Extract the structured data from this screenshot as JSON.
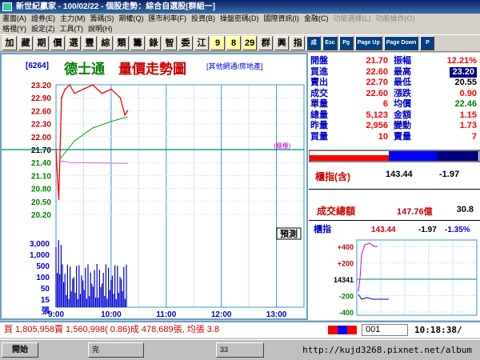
{
  "window": {
    "title": "新世紀贏家 - 100/02/22 - 個股走勢：綜合自選股[群組一]"
  },
  "menu": {
    "row1": [
      "畫面(A)",
      "證券(E)",
      "主力(M)",
      "籌碼(S)",
      "期權(Q)",
      "匯市利率(F)",
      "投資(B)",
      "操盤密碼(D)",
      "國際資訊(I)",
      "金融(C)",
      "功能選擇(L)",
      "功能操作(O)"
    ],
    "row2": [
      "格視(Y)",
      "設定(Z)",
      "工具(T)",
      "說明(H)"
    ]
  },
  "toolbar": {
    "buttons": [
      "加",
      "藏",
      "期",
      "價",
      "選",
      "豐",
      "綜",
      "類",
      "籌",
      "錄",
      "智",
      "委",
      "江",
      "9",
      "8",
      "29",
      "群",
      "興",
      "指"
    ],
    "extra": [
      "成",
      "Esc",
      "Pg",
      "Page Up",
      "Page Down",
      "P"
    ]
  },
  "stock": {
    "code": "[6264]",
    "name": "德士通",
    "chart_title": "量價走勢圖",
    "industry": "[其他網通/房地產]"
  },
  "price_axis": [
    "23.20",
    "22.90",
    "22.60",
    "22.30",
    "22.00",
    "21.70",
    "21.40",
    "21.10",
    "20.80",
    "20.50",
    "20.20"
  ],
  "ref_label": "(櫃檯)",
  "volume_axis": [
    "3,000",
    "1,000",
    "500",
    "100",
    "50",
    "15",
    "張"
  ],
  "time_axis": [
    "9:00",
    "10:00",
    "11:00",
    "12:00",
    "13:00"
  ],
  "prediction_label": "預測",
  "quote": {
    "rows": [
      {
        "l1": "開盤",
        "v1": "21.70",
        "l2": "振幅",
        "v2": "12.21%"
      },
      {
        "l1": "買進",
        "v1": "22.60",
        "l2": "最高",
        "v2": "23.20"
      },
      {
        "l1": "賣出",
        "v1": "22.70",
        "l2": "最低",
        "v2": "20.55"
      },
      {
        "l1": "成交",
        "v1": "22.60",
        "l2": "漲跌",
        "v2": "0.90"
      },
      {
        "l1": "單量",
        "v1": "6",
        "l2": "均價",
        "v2": "22.46"
      },
      {
        "l1": "總量",
        "v1": "5,123",
        "l2": "金額",
        "v2": "1.15"
      },
      {
        "l1": "昨量",
        "v1": "2,956",
        "l2": "變動",
        "v2": "1.73"
      },
      {
        "l1": "買量",
        "v1": "10",
        "l2": "賣量",
        "v2": "7"
      }
    ]
  },
  "otc": {
    "label": "櫃指(含)",
    "value": "143.44",
    "change": "-1.97",
    "total_label": "成交總額",
    "total_value": "147.76億",
    "total_change": "30.8"
  },
  "mini": {
    "label": "櫃指",
    "value": "143.44",
    "change": "-1.97",
    "pct": "-1.35%",
    "axis": [
      "+400",
      "+200",
      "14341",
      "-200",
      "-400"
    ]
  },
  "status": {
    "text": "買 1,805,958賣 1,560,998( 0.86)成 478,689張, 均張 3.8",
    "code": "001",
    "time": "10:18:38/"
  },
  "taskbar": {
    "start": "開始",
    "url": "http://kujd3268.pixnet.net/album",
    "tasks": [
      "完",
      "33"
    ]
  },
  "chart_data": {
    "type": "line",
    "title": "量價走勢圖",
    "x_label": "",
    "y_label": "",
    "ylim": [
      20.2,
      23.2
    ],
    "ref_price": 21.7,
    "price_series": {
      "name": "",
      "x": [
        "9:00",
        "9:03",
        "9:06",
        "9:10",
        "9:15",
        "9:20",
        "9:30",
        "9:40",
        "9:50",
        "10:00",
        "10:10",
        "10:15",
        "10:18"
      ],
      "values": [
        21.7,
        20.55,
        22.9,
        23.1,
        23.2,
        23.0,
        23.1,
        23.2,
        23.0,
        23.1,
        22.9,
        22.5,
        22.6
      ]
    },
    "avg_series": {
      "name": "",
      "x": [
        "9:05",
        "9:20",
        "9:40",
        "10:00",
        "10:18"
      ],
      "values": [
        21.5,
        21.9,
        22.2,
        22.35,
        22.46
      ]
    },
    "volume_hint": "bars at open"
  }
}
